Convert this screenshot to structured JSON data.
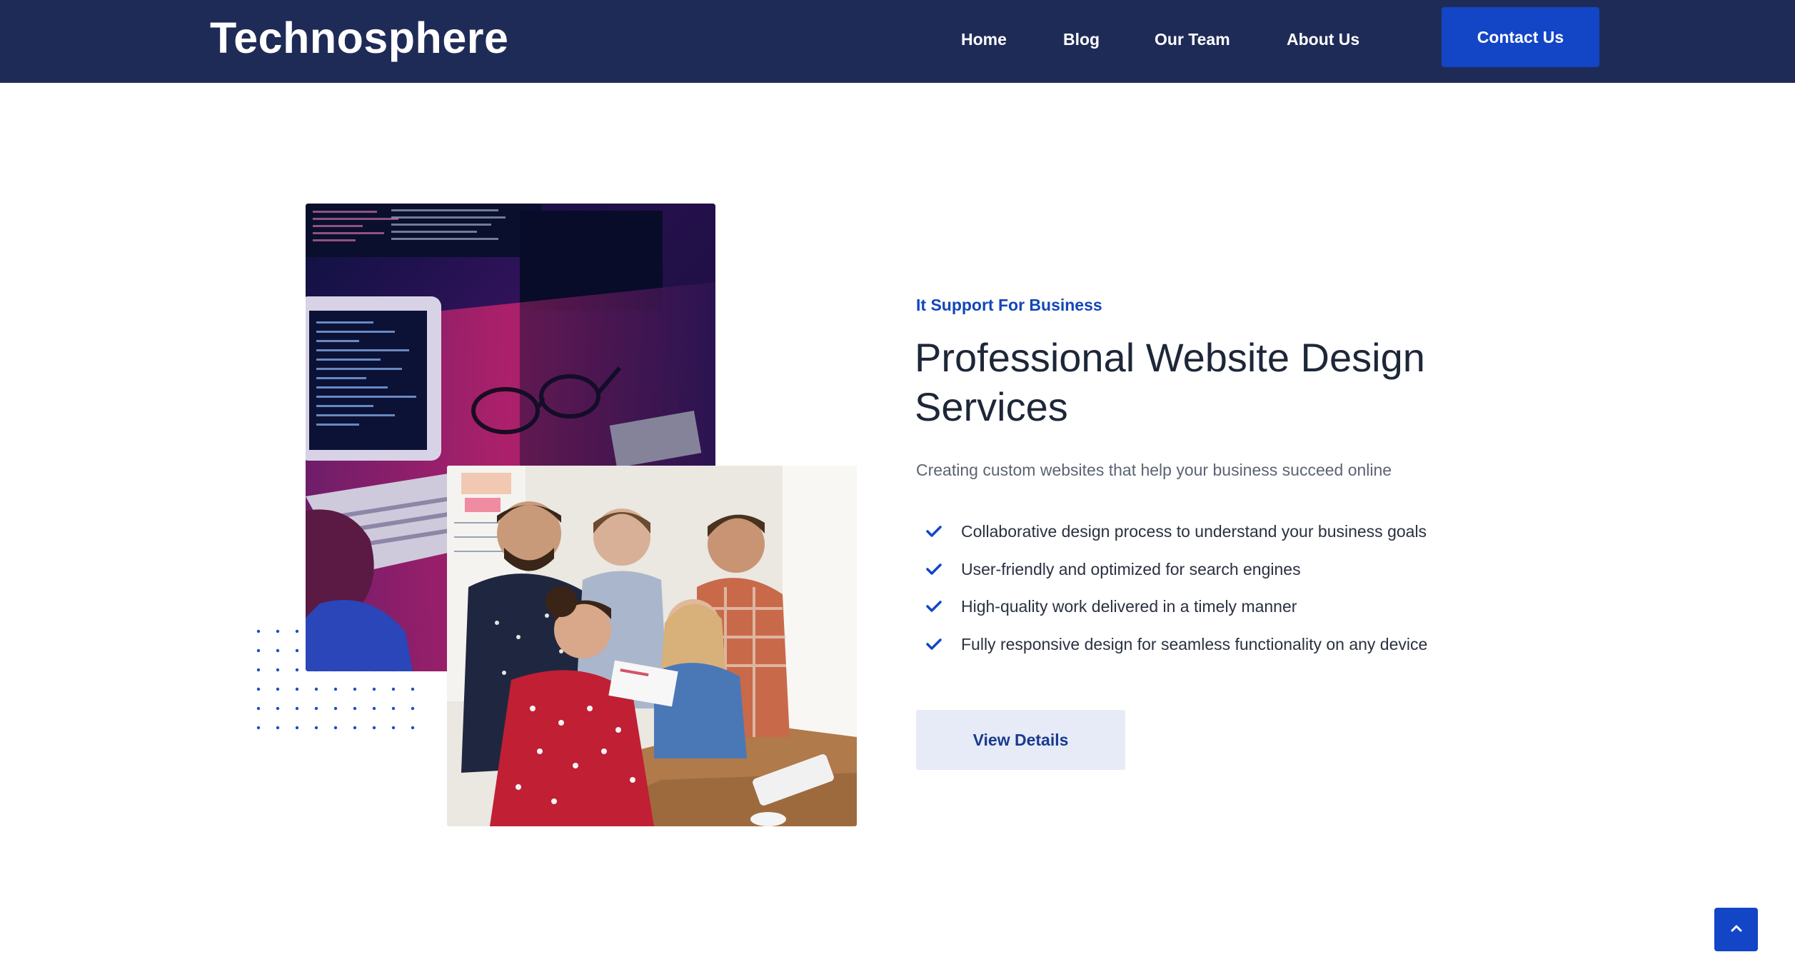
{
  "header": {
    "logo": "Technosphere",
    "nav": [
      {
        "label": "Home"
      },
      {
        "label": "Blog"
      },
      {
        "label": "Our Team"
      },
      {
        "label": "About Us"
      }
    ],
    "contact_label": "Contact Us"
  },
  "images": {
    "back": "laptop-code-photo",
    "front": "team-meeting-photo"
  },
  "section": {
    "eyebrow": "It Support For Business",
    "title": "Professional Website Design Services",
    "subtitle": "Creating custom websites that help your business succeed online",
    "features": [
      "Collaborative design process to understand your business goals",
      "User-friendly and optimized for search engines",
      "High-quality work delivered in a timely manner",
      "Fully responsive design for seamless functionality on any device"
    ],
    "button_label": "View Details"
  },
  "colors": {
    "header_bg": "#1f2b57",
    "accent": "#1345c7",
    "button_light": "#e6ebf7"
  },
  "icons": {
    "check": "check-icon",
    "scroll_top": "chevron-up-icon"
  }
}
